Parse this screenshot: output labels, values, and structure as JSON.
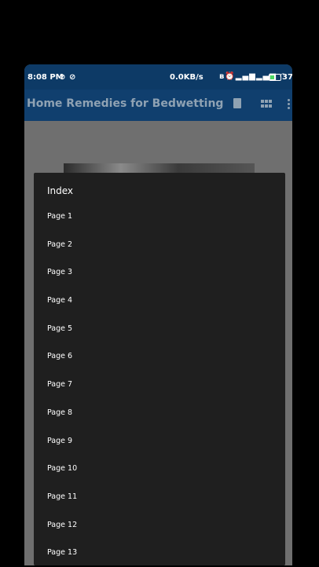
{
  "status_bar": {
    "time": "8:08 PM",
    "speed": "0.0KB/s",
    "battery_level": "37"
  },
  "app_bar": {
    "title": "Home Remedies for Bedwetting",
    "icons": [
      "book-icon",
      "grid-icon",
      "more-vert-icon"
    ]
  },
  "dialog": {
    "title": "Index",
    "items": [
      {
        "label": "Page 1"
      },
      {
        "label": "Page 2"
      },
      {
        "label": "Page 3"
      },
      {
        "label": "Page 4"
      },
      {
        "label": "Page 5"
      },
      {
        "label": "Page 6"
      },
      {
        "label": "Page 7"
      },
      {
        "label": "Page 8"
      },
      {
        "label": "Page 9"
      },
      {
        "label": "Page 10"
      },
      {
        "label": "Page 11"
      },
      {
        "label": "Page 12"
      },
      {
        "label": "Page 13"
      }
    ]
  },
  "colors": {
    "status_bar": "#0d3a66",
    "app_bar": "#103f6e",
    "dialog_bg": "#1f1f1f",
    "scrim": "#606060"
  }
}
